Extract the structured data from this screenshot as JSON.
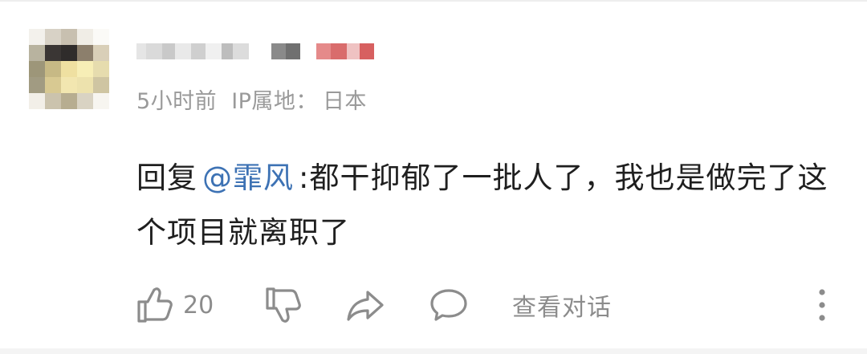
{
  "comment": {
    "meta": {
      "time": "5小时前",
      "ip_label": "IP属地：",
      "ip_location": "日本"
    },
    "reply_prefix": "回复",
    "mention": "@霏风",
    "text_after_mention": ":都干抑郁了一批人了，我也是做完了这个项目就离职了"
  },
  "actions": {
    "like_count": "20",
    "view_conversation_label": "查看对话"
  },
  "icons": {
    "like": "thumbs-up-icon",
    "dislike": "thumbs-down-icon",
    "share": "share-icon",
    "reply": "speech-bubble-icon",
    "more": "more-vertical-icon"
  },
  "colors": {
    "mention": "#3d72b4",
    "meta_text": "#9a9a9a",
    "body_text": "#1f1f1f",
    "icon": "#8c8c8c"
  }
}
